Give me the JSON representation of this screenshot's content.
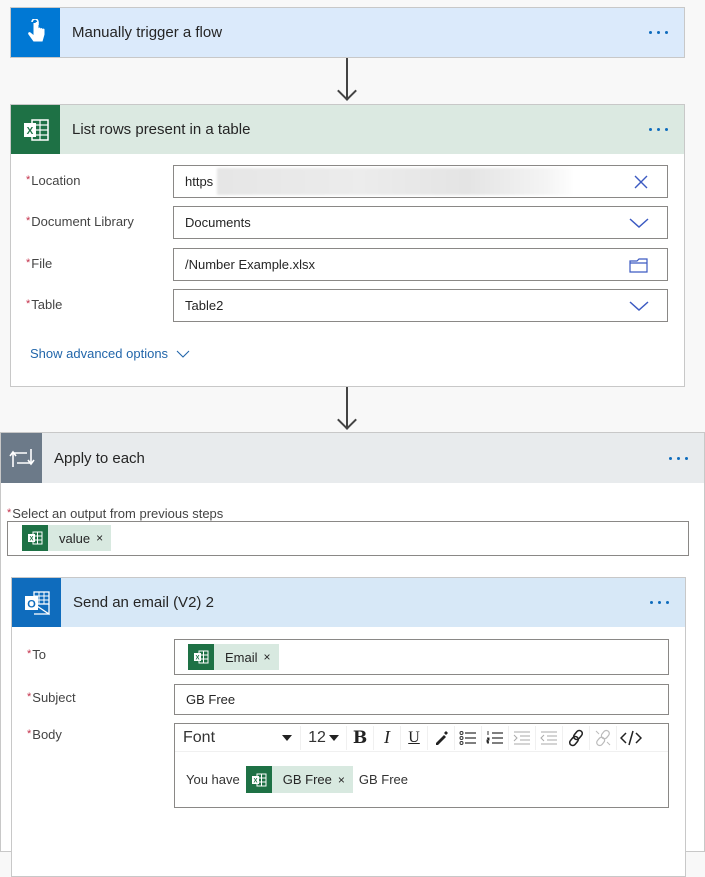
{
  "colors": {
    "trigger_accent": "#0078d4",
    "trigger_header_bg": "#dbeafb",
    "excel_accent": "#1e7145",
    "excel_header_bg": "#dbe9e1",
    "loop_accent": "#6c7a89",
    "loop_header_bg": "#e8ebed",
    "outlook_accent": "#0f6cbd",
    "outlook_header_bg": "#d7e8f7",
    "link": "#2266aa",
    "required": "#c4314b"
  },
  "trigger": {
    "title": "Manually trigger a flow",
    "icon": "touch-hand-icon"
  },
  "list_rows": {
    "title": "List rows present in a table",
    "icon": "excel-icon",
    "fields": [
      {
        "label": "Location",
        "required": true,
        "value": "https",
        "trailing_icon": "clear-icon"
      },
      {
        "label": "Document Library",
        "required": true,
        "value": "Documents",
        "trailing_icon": "chevron-down-icon"
      },
      {
        "label": "File",
        "required": true,
        "value": "/Number Example.xlsx",
        "trailing_icon": "folder-icon"
      },
      {
        "label": "Table",
        "required": true,
        "value": "Table2",
        "trailing_icon": "chevron-down-icon"
      }
    ],
    "advanced_link": "Show advanced options"
  },
  "apply_each": {
    "title": "Apply to each",
    "icon": "loop-icon",
    "select_label": "Select an output from previous steps",
    "token": "value"
  },
  "send_email": {
    "title": "Send an email (V2) 2",
    "icon": "outlook-icon",
    "to_label": "To",
    "to_token": "Email",
    "subject_label": "Subject",
    "subject_value": "GB Free",
    "body_label": "Body",
    "toolbar": {
      "font": "Font",
      "size": "12",
      "bold": "B",
      "italic": "I",
      "underline": "U"
    },
    "body": {
      "prefix": "You have",
      "token": "GB Free",
      "suffix": "GB Free"
    }
  },
  "common": {
    "required_mark": "*",
    "remove_mark": "×"
  }
}
